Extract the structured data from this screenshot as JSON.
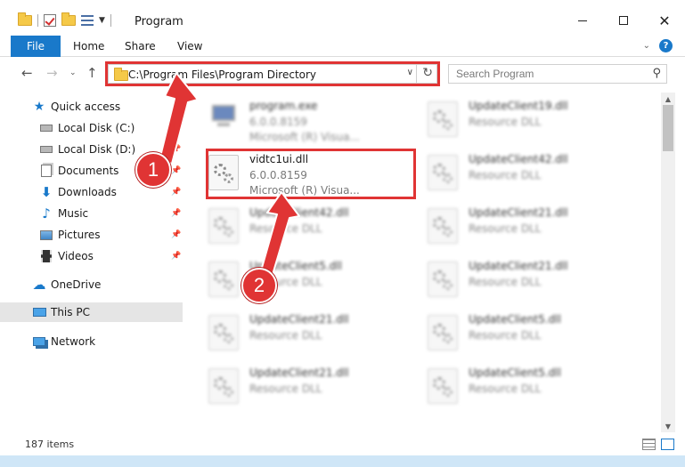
{
  "window": {
    "title": "Program"
  },
  "ribbon": {
    "tabs": [
      {
        "label": "File"
      },
      {
        "label": "Home"
      },
      {
        "label": "Share"
      },
      {
        "label": "View"
      }
    ],
    "help": "?"
  },
  "address": {
    "path": "C:\\Program Files\\Program Directory"
  },
  "search": {
    "placeholder": "Search Program"
  },
  "sidebar": {
    "items": [
      {
        "label": "Quick access",
        "icon": "star-icon"
      },
      {
        "label": "Local Disk (C:)",
        "icon": "drive-icon"
      },
      {
        "label": "Local Disk (D:)",
        "icon": "drive-icon"
      },
      {
        "label": "Documents",
        "icon": "documents-icon"
      },
      {
        "label": "Downloads",
        "icon": "download-icon"
      },
      {
        "label": "Music",
        "icon": "music-icon"
      },
      {
        "label": "Pictures",
        "icon": "pictures-icon"
      },
      {
        "label": "Videos",
        "icon": "videos-icon"
      },
      {
        "label": "OneDrive",
        "icon": "cloud-icon"
      },
      {
        "label": "This PC",
        "icon": "pc-icon"
      },
      {
        "label": "Network",
        "icon": "network-icon"
      }
    ]
  },
  "files": {
    "left": [
      {
        "name": "program.exe",
        "line2": "6.0.0.8159",
        "line3": "Microsoft (R) Visua..."
      },
      {
        "name": "vidtc1ui.dll",
        "line2": "6.0.0.8159",
        "line3": "Microsoft (R) Visua..."
      },
      {
        "name": "UpdateClient42.dll",
        "line2": "Resource DLL"
      },
      {
        "name": "UpdateClient5.dll",
        "line2": "Resource DLL"
      },
      {
        "name": "UpdateClient21.dll",
        "line2": "Resource DLL"
      },
      {
        "name": "UpdateClient21.dll",
        "line2": "Resource DLL"
      }
    ],
    "right": [
      {
        "name": "UpdateClient19.dll",
        "line2": "Resource DLL"
      },
      {
        "name": "UpdateClient42.dll",
        "line2": "Resource DLL"
      },
      {
        "name": "UpdateClient21.dll",
        "line2": "Resource DLL"
      },
      {
        "name": "UpdateClient21.dll",
        "line2": "Resource DLL"
      },
      {
        "name": "UpdateClient5.dll",
        "line2": "Resource DLL"
      },
      {
        "name": "UpdateClient5.dll",
        "line2": "Resource DLL"
      }
    ]
  },
  "status": {
    "items_count": "187 items"
  },
  "annotations": {
    "step1": "1",
    "step2": "2",
    "color": "#e03434"
  },
  "colors": {
    "accent": "#1979ca",
    "highlight": "#e03434"
  }
}
